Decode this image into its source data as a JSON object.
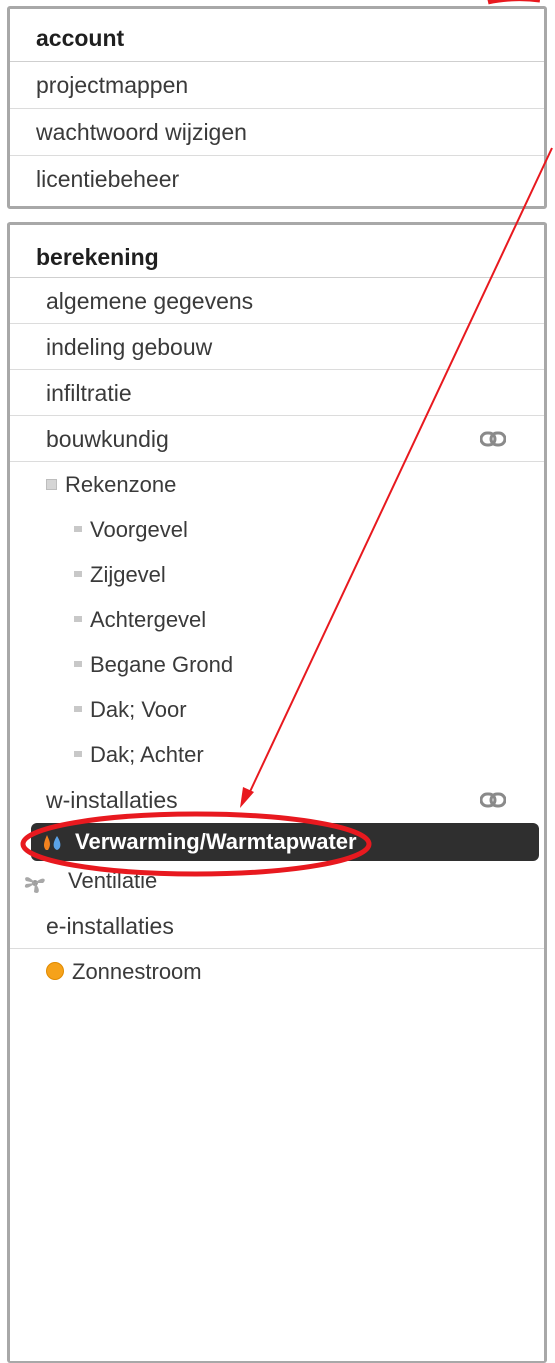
{
  "account_panel": {
    "title": "account",
    "items": [
      "projectmappen",
      "wachtwoord wijzigen",
      "licentiebeheer"
    ]
  },
  "calc_panel": {
    "title": "berekening",
    "items": {
      "general": "algemene gegevens",
      "layout": "indeling gebouw",
      "infiltration": "infiltratie",
      "construction": "bouwkundig",
      "zone": "Rekenzone",
      "front": "Voorgevel",
      "side": "Zijgevel",
      "back": "Achtergevel",
      "ground": "Begane Grond",
      "roof_front": "Dak; Voor",
      "roof_back": "Dak; Achter",
      "w_installations": "w-installaties",
      "heating": "Verwarming/Warmtapwater",
      "ventilation": "Ventilatie",
      "e_installations": "e-installaties",
      "solar": "Zonnestroom"
    }
  },
  "icons": {
    "link": "link-icon",
    "heating": "flame-water-icon",
    "ventilation": "fan-icon",
    "solar": "sun-dot-icon",
    "zone": "collapse-square-icon"
  },
  "colors": {
    "selected_bg": "#2f2f2f",
    "annotation": "#e8191f",
    "solar": "#f6a21a"
  }
}
